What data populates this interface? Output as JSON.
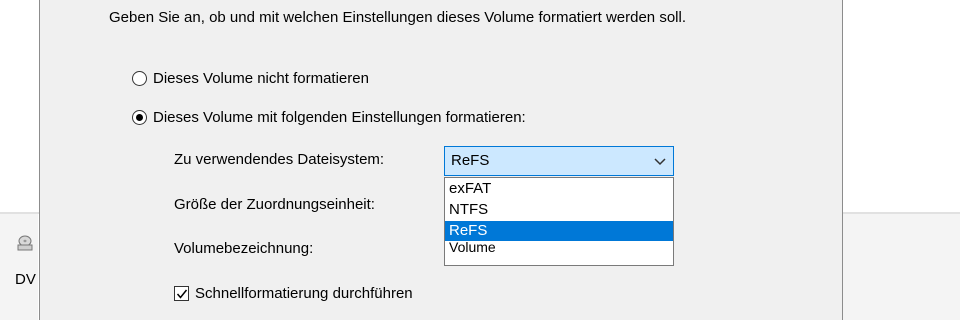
{
  "background": {
    "drive_label": "DV"
  },
  "dialog": {
    "description": "Geben Sie an, ob und mit welchen Einstellungen dieses Volume formatiert werden soll.",
    "option_no_format": {
      "label": "Dieses Volume nicht formatieren",
      "checked": false
    },
    "option_format": {
      "label": "Dieses Volume mit folgenden Einstellungen formatieren:",
      "checked": true
    },
    "filesystem": {
      "label": "Zu verwendendes Dateisystem:",
      "value": "ReFS",
      "options": [
        "exFAT",
        "NTFS",
        "ReFS"
      ],
      "selected_option": "ReFS"
    },
    "allocation_unit_label": "Größe der Zuordnungseinheit:",
    "volume_label": {
      "label": "Volumebezeichnung:",
      "value": "Volume"
    },
    "quick_format": {
      "label": "Schnellformatierung durchführen",
      "checked": true
    }
  },
  "colors": {
    "dialog_bg": "#f0f0f0",
    "accent": "#0078d7",
    "combo_focus_bg": "#cce8ff"
  },
  "icons": {
    "combo_arrow": "chevron-down-icon",
    "drive": "dvd-drive-icon"
  }
}
